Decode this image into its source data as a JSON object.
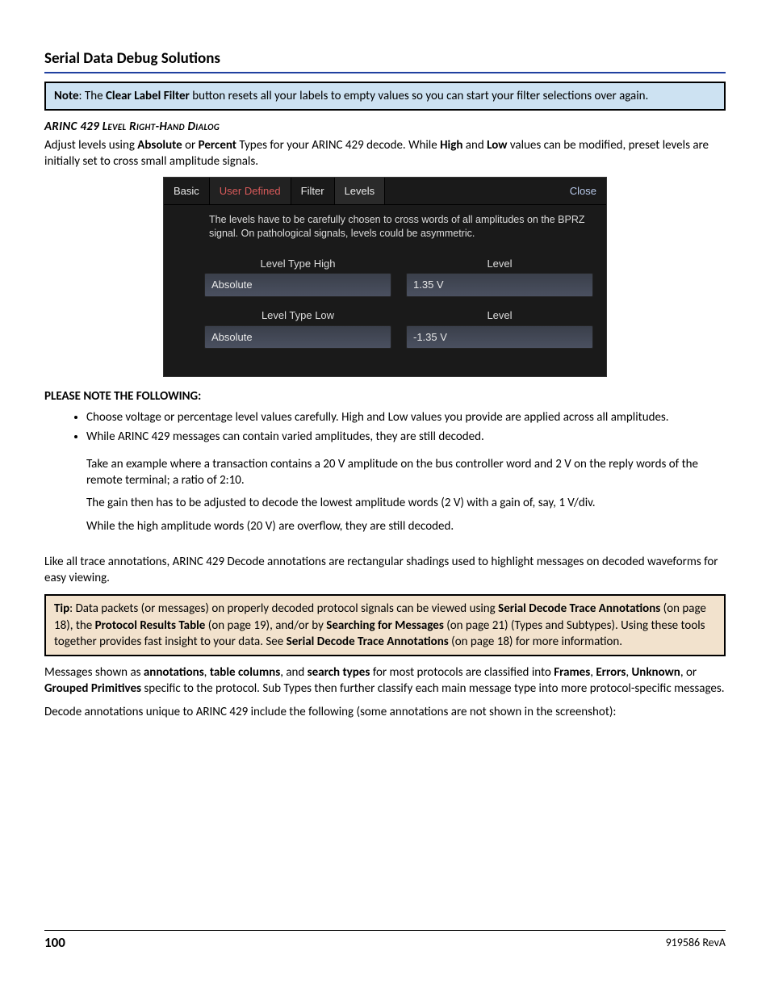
{
  "page": {
    "title": "Serial Data Debug Solutions",
    "note_prefix": "Note",
    "note_body_1": ": The ",
    "note_bold_1": "Clear Label Filter",
    "note_body_2": " button resets all your labels to empty values so you can start your filter selections over again.",
    "subhead": "ARINC 429 Level Right-Hand Dialog",
    "adjust_1": "Adjust levels using ",
    "adjust_b1": "Absolute",
    "adjust_2": " or ",
    "adjust_b2": "Percent",
    "adjust_3": " Types for your ARINC 429 decode. While ",
    "adjust_b3": "High",
    "adjust_4": " and ",
    "adjust_b4": "Low",
    "adjust_5": " values can be modified, preset levels are initially set to cross small amplitude signals."
  },
  "dialog": {
    "tabs": {
      "basic": "Basic",
      "user_defined": "User Defined",
      "filter": "Filter",
      "levels": "Levels"
    },
    "close": "Close",
    "desc": "The levels have to be carefully chosen to cross words of all amplitudes on the BPRZ signal. On pathological signals, levels could be asymmetric.",
    "high": {
      "type_label": "Level Type High",
      "type_value": "Absolute",
      "level_label": "Level",
      "level_value": "1.35 V"
    },
    "low": {
      "type_label": "Level Type Low",
      "type_value": "Absolute",
      "level_label": "Level",
      "level_value": "-1.35 V"
    }
  },
  "pnote": {
    "head_1": "PLEASE NOTE THE FOLLOWING",
    "head_2": ":",
    "bullet1": "Choose voltage or percentage level values carefully. High and Low values you provide are applied across all amplitudes.",
    "bullet2": "While ARINC 429 messages can contain varied amplitudes, they are still decoded.",
    "sub1": "Take an example where a transaction contains a 20 V amplitude on the bus controller word and 2 V on the reply words of the remote terminal; a ratio of 2:10.",
    "sub2": "The gain then has to be adjusted to decode the lowest amplitude words (2 V) with a gain of, say, 1 V/div.",
    "sub3": "While the high amplitude words (20 V) are overflow, they are still decoded."
  },
  "body": {
    "p1": "Like all trace annotations, ARINC 429 Decode annotations are rectangular shadings used to highlight messages on decoded waveforms for easy viewing.",
    "tip_prefix": "Tip",
    "tip_1": ": Data packets (or messages) on properly decoded protocol signals can be viewed using ",
    "tip_b1": "Serial Decode Trace Annotations",
    "tip_2": " (on page 18), the ",
    "tip_b2": "Protocol Results Table",
    "tip_3": " (on page 19), and/or by ",
    "tip_b3": "Searching for Messages",
    "tip_4": " (on page 21) (Types and Subtypes). Using these tools together provides fast insight to your data. See ",
    "tip_b4": "Serial Decode Trace Annotations",
    "tip_5": " (on page 18) for more information.",
    "p2_1": "Messages shown as ",
    "p2_b1": "annotations",
    "p2_2": ", ",
    "p2_b2": "table columns",
    "p2_3": ", and ",
    "p2_b3": "search types",
    "p2_4": " for most protocols are classified into ",
    "p2_b4": "Frames",
    "p2_5": ", ",
    "p2_b5": "Errors",
    "p2_6": ", ",
    "p2_b6": "Unknown",
    "p2_7": ", or ",
    "p2_b7": "Grouped Primitives",
    "p2_8": " specific to the protocol. Sub Types then further classify each main message type into more protocol-specific messages.",
    "p3": "Decode annotations unique to ARINC 429 include the following (some annotations are not shown in the screenshot):"
  },
  "footer": {
    "page_num": "100",
    "rev": "919586 RevA"
  }
}
